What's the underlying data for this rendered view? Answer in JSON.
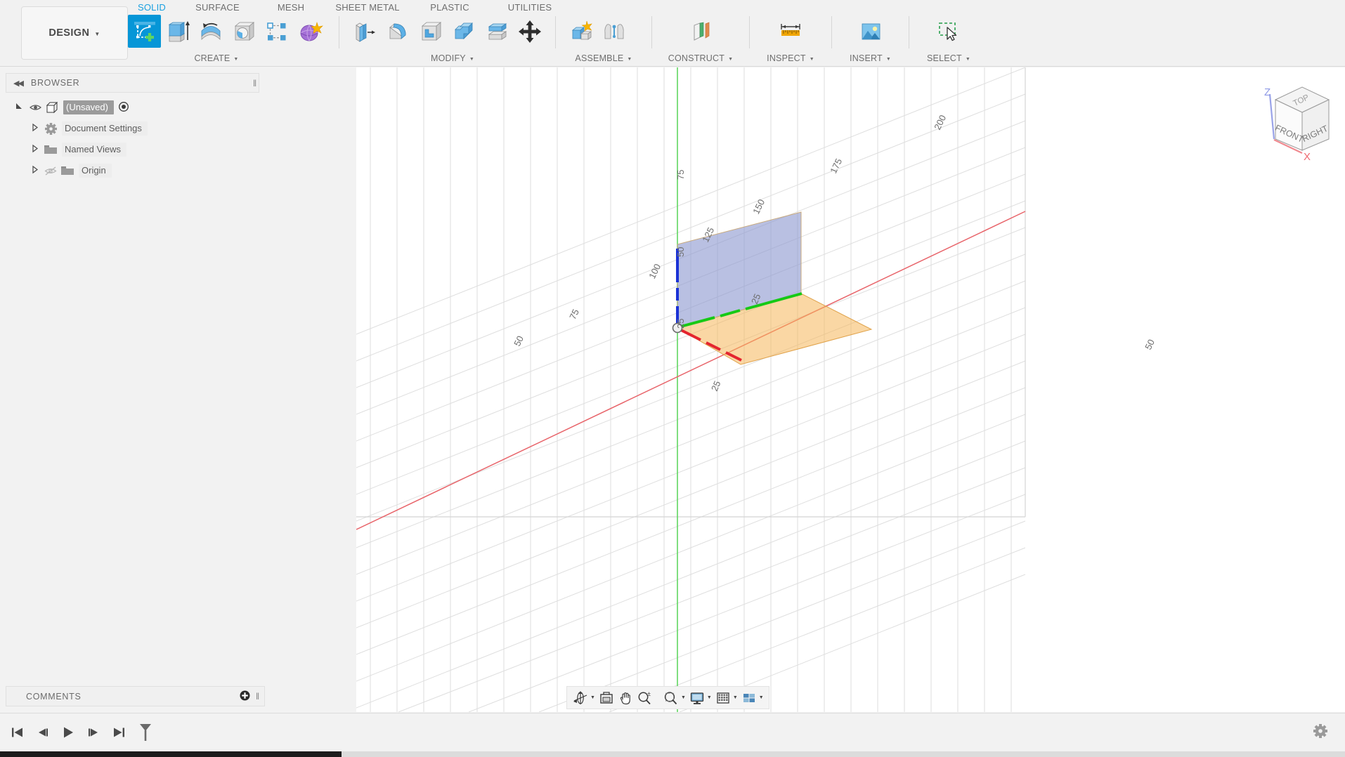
{
  "app": {
    "workspace_button": "DESIGN",
    "tabs": [
      {
        "label": "SOLID",
        "active": true
      },
      {
        "label": "SURFACE",
        "active": false
      },
      {
        "label": "MESH",
        "active": false
      },
      {
        "label": "SHEET METAL",
        "active": false
      },
      {
        "label": "PLASTIC",
        "active": false
      },
      {
        "label": "UTILITIES",
        "active": false
      }
    ],
    "panels": [
      {
        "label": "CREATE",
        "tools": [
          "create-sketch",
          "extrude",
          "revolve",
          "hole",
          "rectangular-pattern",
          "create-form"
        ]
      },
      {
        "label": "MODIFY",
        "tools": [
          "press-pull",
          "fillet",
          "shell",
          "combine",
          "offset-face",
          "move-copy"
        ]
      },
      {
        "label": "ASSEMBLE",
        "tools": [
          "new-component",
          "joint"
        ]
      },
      {
        "label": "CONSTRUCT",
        "tools": [
          "offset-plane"
        ]
      },
      {
        "label": "INSPECT",
        "tools": [
          "measure"
        ]
      },
      {
        "label": "INSERT",
        "tools": [
          "insert-mcmaster"
        ]
      },
      {
        "label": "SELECT",
        "tools": [
          "select-window"
        ]
      }
    ]
  },
  "browser": {
    "title": "BROWSER",
    "tree": [
      {
        "label": "(Unsaved)",
        "icon": "component-icon",
        "level": 0,
        "eye": true,
        "radio": true,
        "arrow": "expanded"
      },
      {
        "label": "Document Settings",
        "icon": "gear-icon",
        "level": 1,
        "eye": false,
        "radio": false,
        "arrow": "collapsed"
      },
      {
        "label": "Named Views",
        "icon": "folder-icon",
        "level": 1,
        "eye": false,
        "radio": false,
        "arrow": "collapsed"
      },
      {
        "label": "Origin",
        "icon": "folder-icon",
        "level": 1,
        "eye": true,
        "eye_off": true,
        "radio": false,
        "arrow": "collapsed"
      }
    ]
  },
  "comments": {
    "title": "COMMENTS"
  },
  "viewport": {
    "viewcube": {
      "faces": [
        "TOP",
        "FRONT",
        "RIGHT"
      ],
      "axis_labels": {
        "z": "Z",
        "x": "X"
      }
    },
    "axes": {
      "x_axis_color": "#e8ararr",
      "x_ticks": [
        "50",
        "75",
        "100",
        "125"
      ],
      "y_ticks": [
        "25",
        "50",
        "75"
      ],
      "plane_labels": [
        "25",
        "50",
        "25"
      ]
    },
    "origin_planes": [
      {
        "name": "front-plane",
        "color": "#9aa7d8"
      },
      {
        "name": "top-plane",
        "color": "#f5b553"
      }
    ],
    "colors": {
      "x_axis": "#e8646a",
      "y_axis": "#5fd65f",
      "z_axis": "#2a3fe0",
      "grid": "#dddddd",
      "background": "#ffffff"
    }
  },
  "navbar": {
    "items": [
      {
        "name": "orbit",
        "caret": true
      },
      {
        "name": "look-at",
        "caret": false
      },
      {
        "name": "pan",
        "caret": false
      },
      {
        "name": "zoom",
        "caret": false
      },
      {
        "name": "zoom-window",
        "caret": true
      },
      {
        "name": "display-settings",
        "caret": true
      },
      {
        "name": "grid-snaps",
        "caret": true
      },
      {
        "name": "viewport-layout",
        "caret": true
      }
    ]
  },
  "timeline": {
    "controls": [
      {
        "name": "go-to-beginning"
      },
      {
        "name": "step-back"
      },
      {
        "name": "play-back"
      },
      {
        "name": "step-forward"
      },
      {
        "name": "go-to-end"
      },
      {
        "name": "filter"
      }
    ],
    "settings": "settings-gear"
  }
}
